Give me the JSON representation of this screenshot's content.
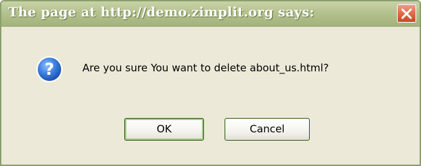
{
  "dialog": {
    "title": "The page at http://demo.zimplit.org says:",
    "message": "Are you sure You want to delete about_us.html?",
    "icon": "question-icon",
    "buttons": {
      "ok_label": "OK",
      "cancel_label": "Cancel"
    },
    "colors": {
      "titlebar": "#b4c28f",
      "body": "#ece9d8",
      "close_button": "#e0704e",
      "icon": "#2f6fcf"
    }
  }
}
